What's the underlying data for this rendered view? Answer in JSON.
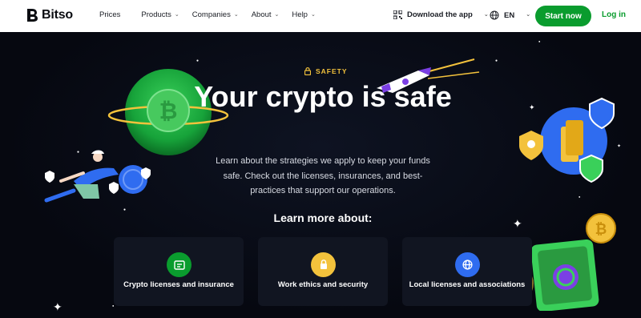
{
  "brand": {
    "name": "Bitso",
    "accent": "#0a9c2e"
  },
  "nav": {
    "items": [
      {
        "label": "Prices",
        "has_menu": false
      },
      {
        "label": "Products",
        "has_menu": true
      },
      {
        "label": "Companies",
        "has_menu": true
      },
      {
        "label": "About",
        "has_menu": true
      },
      {
        "label": "Help",
        "has_menu": true
      }
    ],
    "download_label": "Download the app",
    "language": "EN",
    "start_label": "Start now",
    "login_label": "Log in"
  },
  "hero": {
    "eyebrow": "SAFETY",
    "title": "Your crypto is safe",
    "description": "Learn about the strategies we apply to keep your funds safe. Check out the licenses, insurances, and best-practices that support our operations.",
    "learn_more": "Learn more about:"
  },
  "cards": [
    {
      "label": "Crypto licenses and insurance",
      "icon": "license-icon",
      "color": "#0a9c2e"
    },
    {
      "label": "Work ethics and security",
      "icon": "lock-icon",
      "color": "#f3c23c"
    },
    {
      "label": "Local licenses and associations",
      "icon": "globe-icon",
      "color": "#2f6cf0"
    }
  ]
}
